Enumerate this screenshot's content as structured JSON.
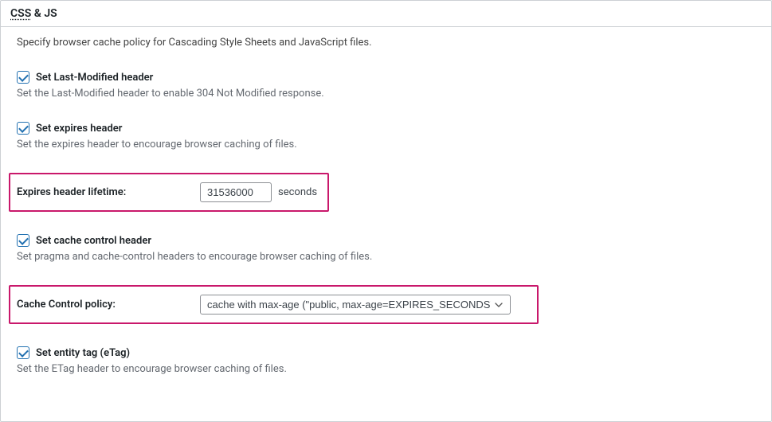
{
  "panel": {
    "title_part1": "CSS",
    "title_connector": " & ",
    "title_part2": "JS"
  },
  "description": "Specify browser cache policy for Cascading Style Sheets and JavaScript files.",
  "fields": {
    "last_modified": {
      "label": "Set Last-Modified header",
      "desc": "Set the Last-Modified header to enable 304 Not Modified response.",
      "checked": true
    },
    "expires": {
      "label": "Set expires header",
      "desc": "Set the expires header to encourage browser caching of files.",
      "checked": true
    },
    "expires_lifetime": {
      "label": "Expires header lifetime:",
      "value": "31536000",
      "suffix": "seconds"
    },
    "cache_control": {
      "label": "Set cache control header",
      "desc": "Set pragma and cache-control headers to encourage browser caching of files.",
      "checked": true
    },
    "cache_control_policy": {
      "label": "Cache Control policy:",
      "selected": "cache with max-age (\"public, max-age=EXPIRES_SECONDS\""
    },
    "etag": {
      "label": "Set entity tag (eTag)",
      "desc": "Set the ETag header to encourage browser caching of files.",
      "checked": true
    }
  }
}
